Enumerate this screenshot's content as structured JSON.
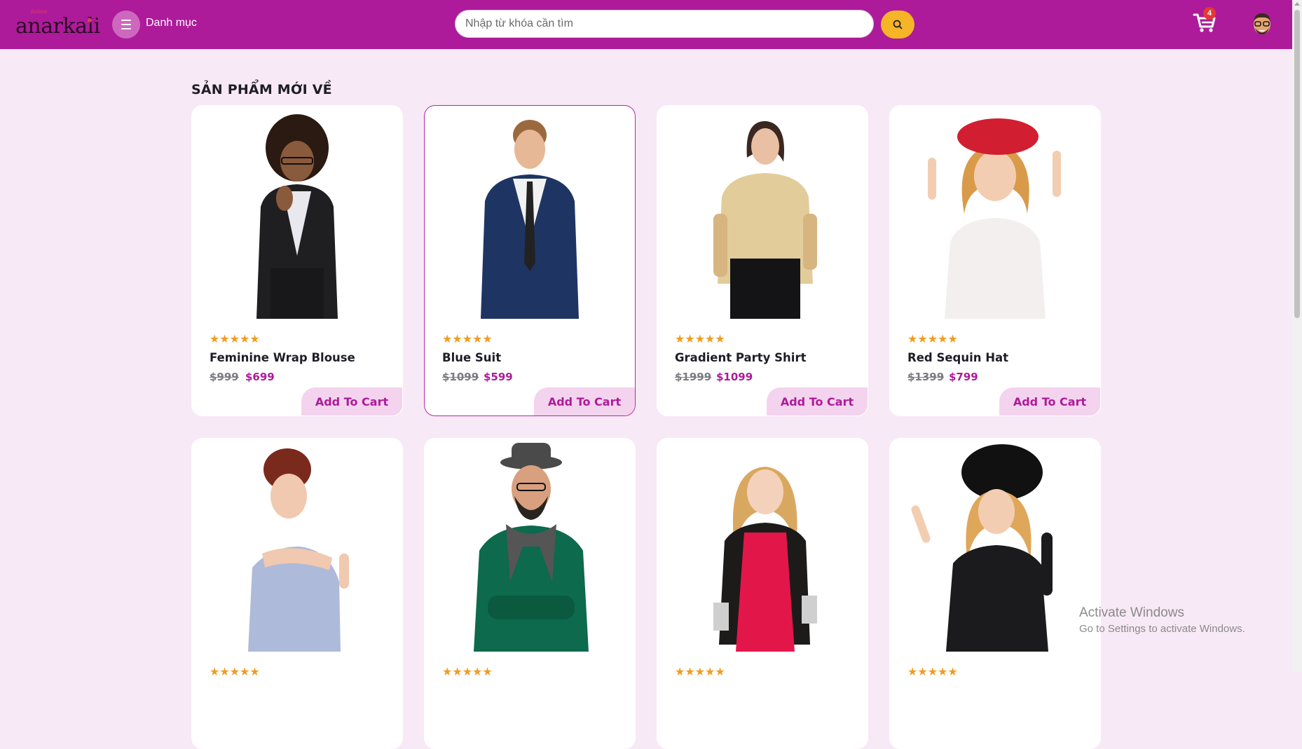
{
  "header": {
    "logo_text": "anarkali",
    "logo_tagline": "fashion",
    "menu_label": "Danh mục",
    "search_placeholder": "Nhập từ khóa cần tìm",
    "cart_count": "4",
    "brand_color": "#ad1b9a",
    "accent_color": "#f6b427"
  },
  "section": {
    "title": "SẢN PHẨM MỚI VỀ"
  },
  "products": [
    {
      "name": "Feminine Wrap Blouse",
      "old_price": "$999",
      "price": "$699",
      "stars": "★★★★★",
      "cta": "Add To Cart"
    },
    {
      "name": "Blue Suit",
      "old_price": "$1099",
      "price": "$599",
      "stars": "★★★★★",
      "cta": "Add To Cart"
    },
    {
      "name": "Gradient Party Shirt",
      "old_price": "$1999",
      "price": "$1099",
      "stars": "★★★★★",
      "cta": "Add To Cart"
    },
    {
      "name": "Red Sequin Hat",
      "old_price": "$1399",
      "price": "$799",
      "stars": "★★★★★",
      "cta": "Add To Cart"
    },
    {
      "stars": "★★★★★"
    },
    {
      "stars": "★★★★★"
    },
    {
      "stars": "★★★★★"
    },
    {
      "stars": "★★★★★"
    }
  ],
  "os_watermark": {
    "line1": "Activate Windows",
    "line2": "Go to Settings to activate Windows."
  }
}
